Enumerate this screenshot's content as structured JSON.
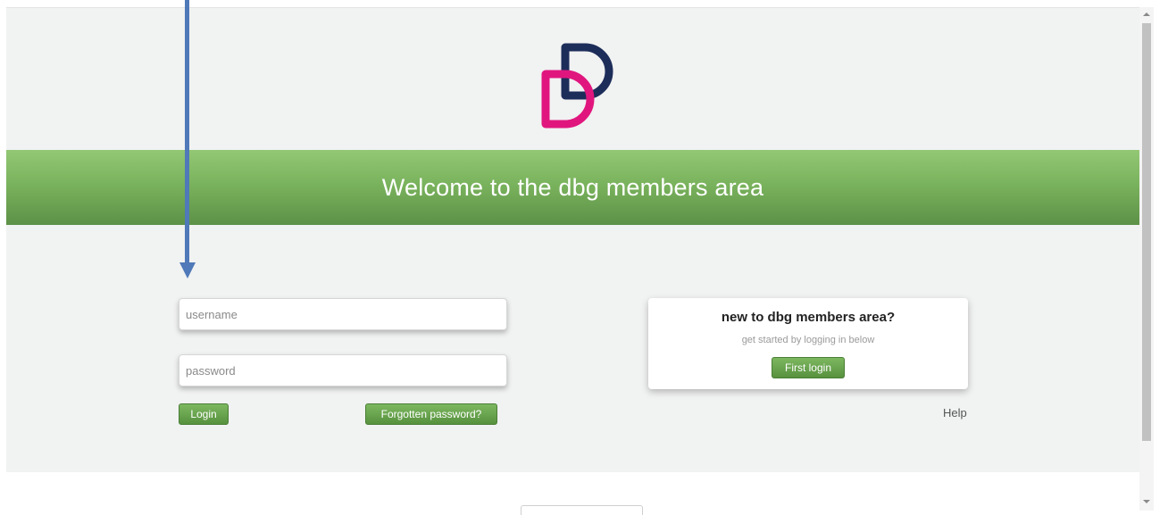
{
  "brand": {
    "primary_color": "#1d2d5a",
    "accent_color": "#e0167e",
    "logo_icon": "dbg-logo"
  },
  "banner": {
    "title": "Welcome to the dbg members area",
    "color": "#7ab35d"
  },
  "login_form": {
    "username_placeholder": "username",
    "username_value": "",
    "password_placeholder": "password",
    "password_value": "",
    "login_label": "Login",
    "forgot_label": "Forgotten password?"
  },
  "new_member_card": {
    "title": "new to dbg members area?",
    "subtitle": "get started by logging in below",
    "button_label": "First login"
  },
  "help": {
    "label": "Help"
  },
  "annotation": {
    "icon": "arrow-down-icon",
    "color": "#4f79b8"
  }
}
